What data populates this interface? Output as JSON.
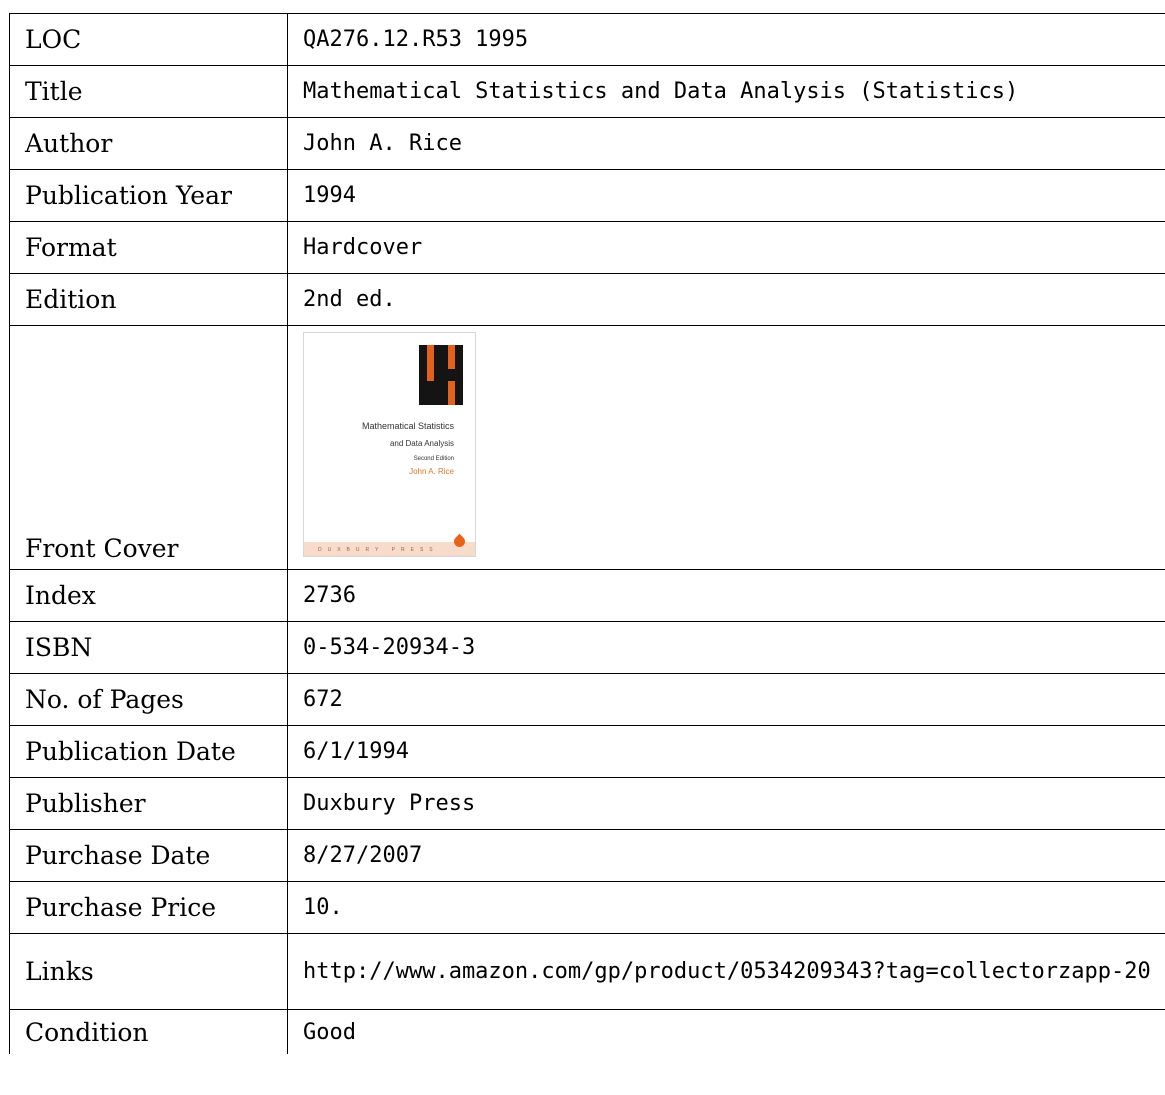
{
  "rows": [
    {
      "label": "LOC",
      "value": "QA276.12.R53 1995"
    },
    {
      "label": "Title",
      "value": "Mathematical Statistics and Data Analysis (Statistics)"
    },
    {
      "label": "Author",
      "value": "John A. Rice"
    },
    {
      "label": "Publication Year",
      "value": "1994"
    },
    {
      "label": "Format",
      "value": "Hardcover"
    },
    {
      "label": "Edition",
      "value": "2nd ed."
    },
    {
      "label": "Front Cover"
    },
    {
      "label": "Index",
      "value": "2736"
    },
    {
      "label": "ISBN",
      "value": "0-534-20934-3"
    },
    {
      "label": "No. of Pages",
      "value": "672"
    },
    {
      "label": "Publication Date",
      "value": "6/1/1994"
    },
    {
      "label": "Publisher",
      "value": "Duxbury Press"
    },
    {
      "label": "Purchase Date",
      "value": "8/27/2007"
    },
    {
      "label": "Purchase Price",
      "value": "10."
    },
    {
      "label": "Links",
      "value": "http://www.amazon.com/gp/product/0534209343?tag=collectorzapp-20"
    },
    {
      "label": "Condition",
      "value": "Good"
    }
  ],
  "cover": {
    "title_line1": "Mathematical Statistics",
    "title_line2": "and Data Analysis",
    "edition": "Second Edition",
    "author": "John A. Rice",
    "publisher": "DUXBURY PRESS",
    "colors": {
      "accent": "#e2611c",
      "block": "#141414",
      "footer": "#f7dccb"
    }
  }
}
